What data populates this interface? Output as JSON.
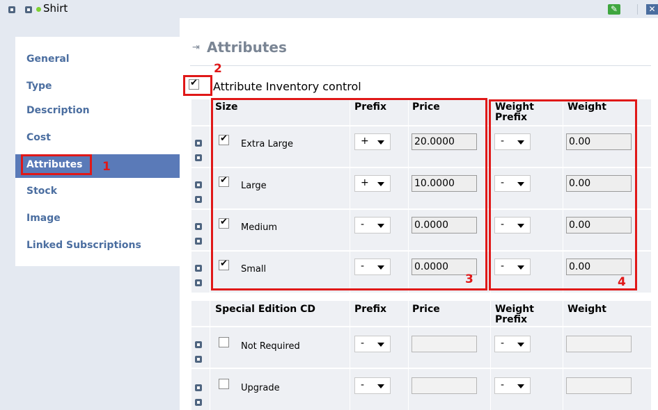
{
  "topbar": {
    "title": "Shirt"
  },
  "nav": {
    "items": [
      {
        "label": "General"
      },
      {
        "label": "Type"
      },
      {
        "label": "Description"
      },
      {
        "label": "Cost"
      },
      {
        "label": "Attributes"
      },
      {
        "label": "Stock"
      },
      {
        "label": "Image"
      },
      {
        "label": "Linked Subscriptions"
      }
    ],
    "active": "Attributes"
  },
  "annotations": [
    "1",
    "2",
    "3",
    "4"
  ],
  "main": {
    "title": "Attributes",
    "inventory_control": {
      "label": "Attribute Inventory control",
      "checked": true
    }
  },
  "groups": [
    {
      "headers": {
        "name": "Size",
        "prefix": "Prefix",
        "price": "Price",
        "weight_prefix": "Weight Prefix",
        "weight": "Weight"
      },
      "rows": [
        {
          "label": "Extra Large",
          "checked": true,
          "prefix": "+",
          "price": "20.0000",
          "weight_prefix": "-",
          "weight": "0.00"
        },
        {
          "label": "Large",
          "checked": true,
          "prefix": "+",
          "price": "10.0000",
          "weight_prefix": "-",
          "weight": "0.00"
        },
        {
          "label": "Medium",
          "checked": true,
          "prefix": "-",
          "price": "0.0000",
          "weight_prefix": "-",
          "weight": "0.00"
        },
        {
          "label": "Small",
          "checked": true,
          "prefix": "-",
          "price": "0.0000",
          "weight_prefix": "-",
          "weight": "0.00"
        }
      ]
    },
    {
      "headers": {
        "name": "Special Edition CD",
        "prefix": "Prefix",
        "price": "Price",
        "weight_prefix": "Weight Prefix",
        "weight": "Weight"
      },
      "rows": [
        {
          "label": "Not Required",
          "checked": false,
          "prefix": "-",
          "price": "",
          "weight_prefix": "-",
          "weight": ""
        },
        {
          "label": "Upgrade",
          "checked": false,
          "prefix": "-",
          "price": "",
          "weight_prefix": "-",
          "weight": ""
        }
      ]
    }
  ],
  "colors": {
    "accent_red": "#e01818",
    "nav_active": "#5a7ab8",
    "nav_text": "#4b6ea0"
  }
}
